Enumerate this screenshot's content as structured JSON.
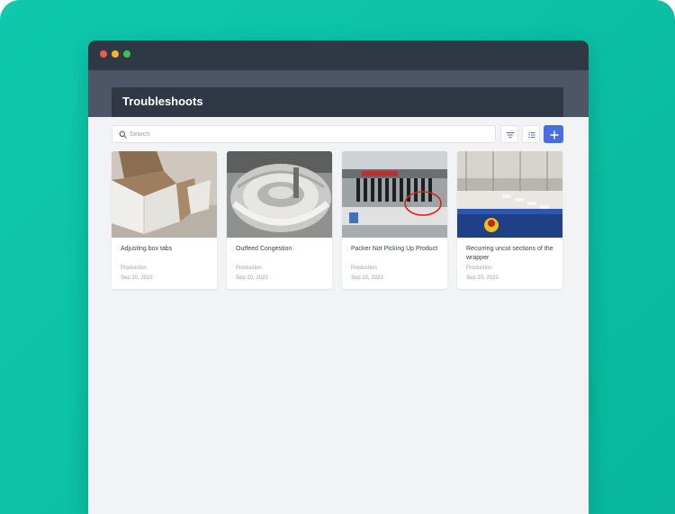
{
  "page": {
    "title": "Troubleshoots"
  },
  "search": {
    "placeholder": "Search"
  },
  "toolbar": {
    "filter_icon": "filter-icon",
    "list_icon": "list-icon",
    "add_icon": "plus-icon",
    "accent_color": "#4a6ee0"
  },
  "cards": [
    {
      "title": "Adjusting box tabs",
      "category": "Production",
      "date": "Sep 20, 2023",
      "image": "cardboard-box-photo"
    },
    {
      "title": "Outfeed Congestion",
      "category": "Production",
      "date": "Sep 20, 2023",
      "image": "bottle-outfeed-photo"
    },
    {
      "title": "Packer Not Picking Up Product",
      "category": "Production",
      "date": "Sep 20, 2023",
      "image": "packer-machine-photo"
    },
    {
      "title": "Recurring uncut sections of the wrapper",
      "category": "Production",
      "date": "Sep 20, 2023",
      "image": "wrapper-machine-photo"
    }
  ],
  "colors": {
    "backdrop": "#0fc9ab",
    "titlebar": "#303846",
    "header_band": "#4c5666"
  }
}
